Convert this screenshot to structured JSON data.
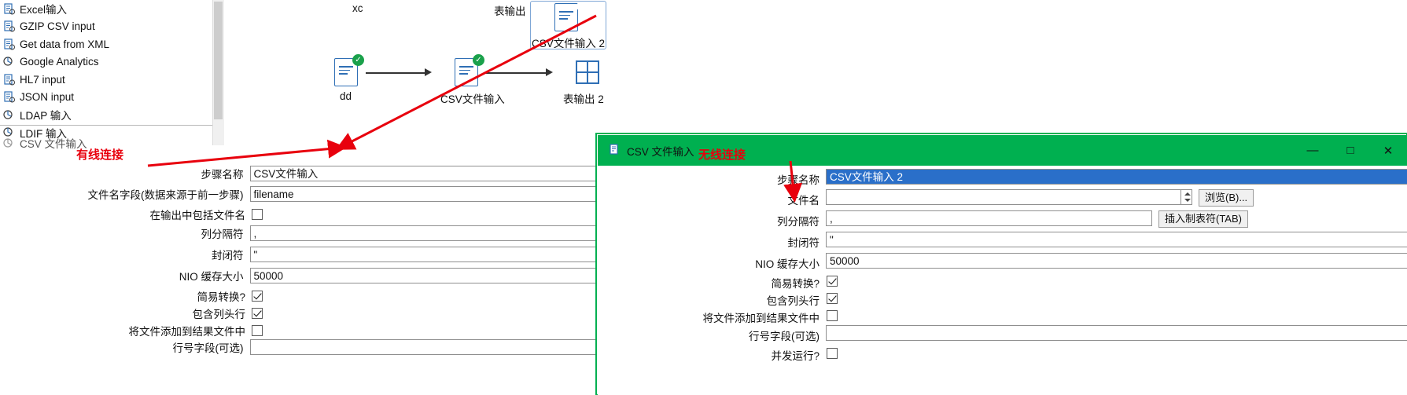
{
  "tree": {
    "items": [
      {
        "label": "Excel输入",
        "icon": "excel-input-icon"
      },
      {
        "label": "GZIP CSV input",
        "icon": "gzip-csv-input-icon"
      },
      {
        "label": "Get data from XML",
        "icon": "xml-input-icon"
      },
      {
        "label": "Google Analytics",
        "icon": "google-analytics-icon"
      },
      {
        "label": "HL7 input",
        "icon": "hl7-input-icon"
      },
      {
        "label": "JSON input",
        "icon": "json-input-icon"
      },
      {
        "label": "LDAP 输入",
        "icon": "ldap-input-icon"
      },
      {
        "label": "LDIF 输入",
        "icon": "ldif-input-icon"
      }
    ],
    "active_tab": "CSV 文件输入"
  },
  "canvas": {
    "labels": {
      "xc": "xc",
      "table_output": "表输出",
      "selected_step": "CSV文件输入 2",
      "step_dd": "dd",
      "step_csv": "CSV文件输入",
      "step_table_out2": "表输出 2"
    }
  },
  "annotations": {
    "wired": "有线连接",
    "wireless": "无线连接",
    "color": "#e8000d"
  },
  "left_dialog": {
    "rows": [
      {
        "label": "步骤名称",
        "type": "text",
        "value": "CSV文件输入"
      },
      {
        "label": "文件名字段(数据来源于前一步骤)",
        "type": "text",
        "value": "filename"
      },
      {
        "label": "在输出中包括文件名",
        "type": "checkbox",
        "checked": false
      },
      {
        "label": "列分隔符",
        "type": "text",
        "value": ","
      },
      {
        "label": "封闭符",
        "type": "text",
        "value": "\""
      },
      {
        "label": "NIO 缓存大小",
        "type": "text",
        "value": "50000"
      },
      {
        "label": "简易转换?",
        "type": "checkbox",
        "checked": true
      },
      {
        "label": "包含列头行",
        "type": "checkbox",
        "checked": true
      },
      {
        "label": "将文件添加到结果文件中",
        "type": "checkbox",
        "checked": false
      },
      {
        "label": "行号字段(可选)",
        "type": "text",
        "value": ""
      }
    ]
  },
  "right_dialog": {
    "title": "CSV 文件输入",
    "title_icon": "csv-file-input-icon",
    "window_buttons": {
      "minimize": "—",
      "maximize": "□",
      "close": "✕"
    },
    "rows": [
      {
        "label": "步骤名称",
        "type": "text",
        "value": "CSV文件输入 2",
        "selected": true
      },
      {
        "label": "文件名",
        "type": "text-spinner-button",
        "value": "",
        "button": "浏览(B)..."
      },
      {
        "label": "列分隔符",
        "type": "text-button",
        "value": ",",
        "button": "插入制表符(TAB)"
      },
      {
        "label": "封闭符",
        "type": "text",
        "value": "\""
      },
      {
        "label": "NIO 缓存大小",
        "type": "text",
        "value": "50000"
      },
      {
        "label": "简易转换?",
        "type": "checkbox",
        "checked": true
      },
      {
        "label": "包含列头行",
        "type": "checkbox",
        "checked": true
      },
      {
        "label": "将文件添加到结果文件中",
        "type": "checkbox",
        "checked": false
      },
      {
        "label": "行号字段(可选)",
        "type": "text",
        "value": ""
      },
      {
        "label": "并发运行?",
        "type": "checkbox",
        "checked": false
      }
    ]
  }
}
